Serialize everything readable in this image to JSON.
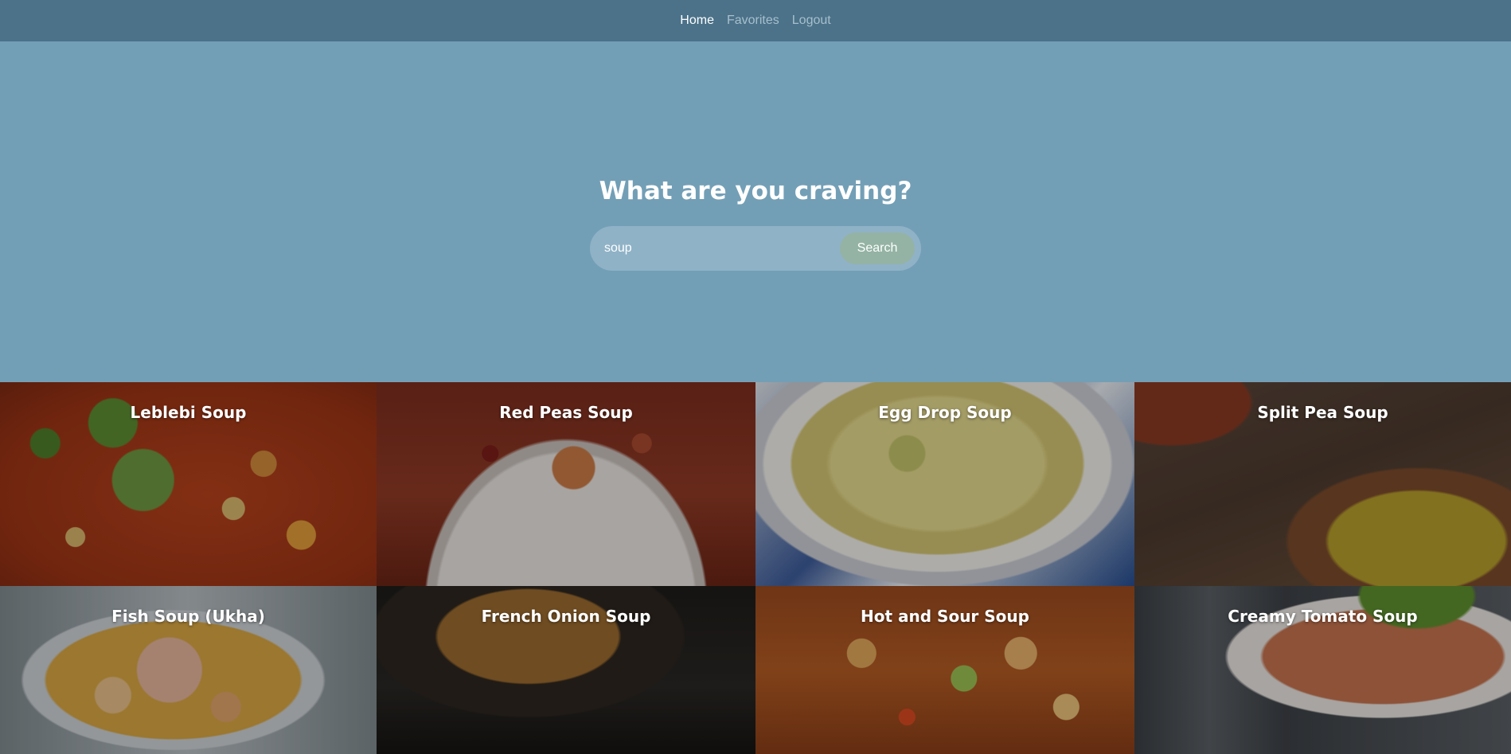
{
  "nav": {
    "items": [
      {
        "label": "Home"
      },
      {
        "label": "Favorites"
      },
      {
        "label": "Logout"
      }
    ]
  },
  "hero": {
    "title": "What are you craving?",
    "search": {
      "value": "soup",
      "button_label": "Search"
    }
  },
  "results": [
    {
      "title": "Leblebi Soup"
    },
    {
      "title": "Red Peas Soup"
    },
    {
      "title": "Egg Drop Soup"
    },
    {
      "title": "Split Pea Soup"
    },
    {
      "title": "Fish Soup (Ukha)"
    },
    {
      "title": "French Onion Soup"
    },
    {
      "title": "Hot and Sour Soup"
    },
    {
      "title": "Creamy Tomato Soup"
    }
  ],
  "colors": {
    "nav_bg": "#4b7289",
    "hero_bg": "#739fb6",
    "search_bar_bg": "#8fb2c7",
    "search_button_bg": "#94b3a4"
  }
}
